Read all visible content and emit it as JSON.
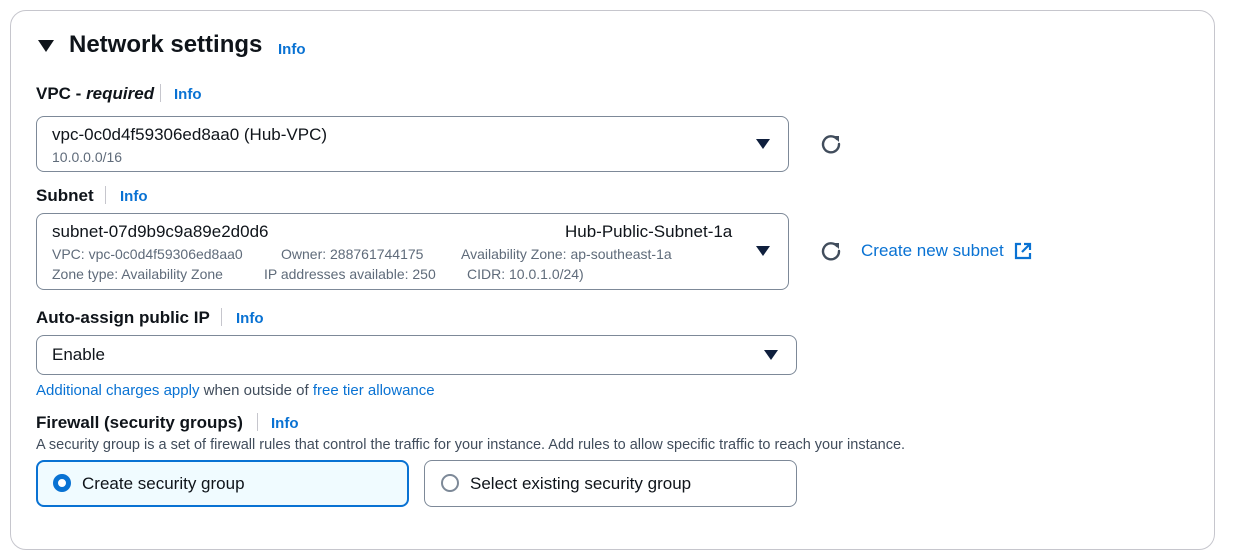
{
  "section": {
    "title": "Network settings",
    "info": "Info"
  },
  "vpc": {
    "label_main": "VPC - ",
    "label_req": "required",
    "info": "Info",
    "value": "vpc-0c0d4f59306ed8aa0 (Hub-VPC)",
    "sub": "10.0.0.0/16"
  },
  "subnet": {
    "label": "Subnet",
    "info": "Info",
    "id": "subnet-07d9b9c9a89e2d0d6",
    "name": "Hub-Public-Subnet-1a",
    "vpc": "VPC: vpc-0c0d4f59306ed8aa0",
    "owner": "Owner: 288761744175",
    "az": "Availability Zone: ap-southeast-1a",
    "zone_type": "Zone type: Availability Zone",
    "ips": "IP addresses available: 250",
    "cidr": "CIDR: 10.0.1.0/24)",
    "create_link": "Create new subnet"
  },
  "public_ip": {
    "label": "Auto-assign public IP",
    "info": "Info",
    "value": "Enable",
    "hint_link1": "Additional charges apply",
    "hint_text": " when outside of ",
    "hint_link2": "free tier allowance"
  },
  "firewall": {
    "label": "Firewall (security groups)",
    "info": "Info",
    "description": "A security group is a set of firewall rules that control the traffic for your instance. Add rules to allow specific traffic to reach your instance.",
    "options": [
      {
        "label": "Create security group",
        "selected": true
      },
      {
        "label": "Select existing security group",
        "selected": false
      }
    ]
  },
  "colors": {
    "link": "#0972d3",
    "text": "#0f141a",
    "muted": "#5f6b7a"
  },
  "icons": [
    "caret-down-filled-icon",
    "refresh-icon",
    "external-link-icon",
    "dropdown-triangle-icon"
  ]
}
